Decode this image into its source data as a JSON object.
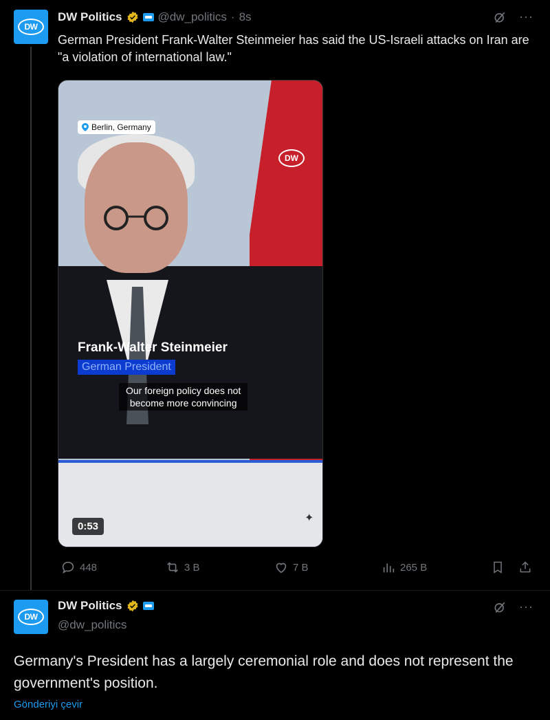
{
  "tweet": {
    "author_name": "DW Politics",
    "handle": "@dw_politics",
    "separator": "·",
    "time": "8s",
    "text": "German President Frank-Walter Steinmeier has said the US-Israeli attacks on Iran are \"a violation of international law.\"",
    "avatar_text": "DW",
    "media": {
      "location": "Berlin, Germany",
      "watermark": "DW",
      "speaker_name": "Frank-Walter Steinmeier",
      "speaker_role": "German President",
      "caption_line1": "Our foreign policy does not",
      "caption_line2": "become more convincing",
      "duration": "0:53"
    },
    "actions": {
      "replies": "448",
      "reposts": "3 B",
      "likes": "7 B",
      "views": "265 B"
    }
  },
  "reply": {
    "author_name": "DW Politics",
    "handle": "@dw_politics",
    "avatar_text": "DW",
    "text": "Germany's President has a largely ceremonial role and does not represent the government's position.",
    "translate_label": "Gönderiyi çevir"
  },
  "icons": {
    "verified": "verified-badge-icon",
    "gov": "government-affiliation-icon",
    "grok": "grok-icon",
    "more": "more-icon"
  },
  "colors": {
    "accent": "#1d9bf0",
    "verified_gold": "#e2b719",
    "background": "#000000",
    "muted": "#71767b"
  }
}
